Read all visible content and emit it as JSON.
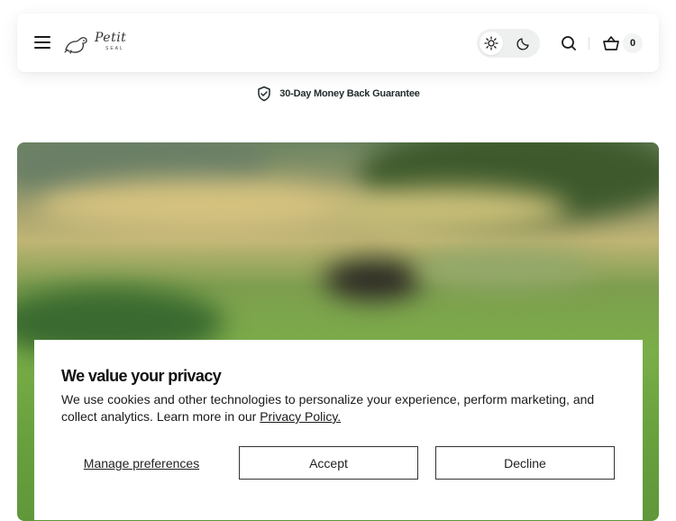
{
  "header": {
    "logo_text": "Petit",
    "logo_sub": "SEAL",
    "cart_count": "0",
    "icons": [
      "menu-icon",
      "sun-icon",
      "moon-icon",
      "search-icon",
      "cart-icon"
    ]
  },
  "guarantee": {
    "text": "30-Day Money Back Guarantee",
    "icon": "shield-check-icon"
  },
  "cookie_banner": {
    "title": "We value your privacy",
    "body": "We use cookies and other technologies to personalize your experience, perform marketing, and collect analytics. Learn more in our ",
    "policy_link": "Privacy Policy.",
    "manage_label": "Manage preferences",
    "accept_label": "Accept",
    "decline_label": "Decline"
  }
}
